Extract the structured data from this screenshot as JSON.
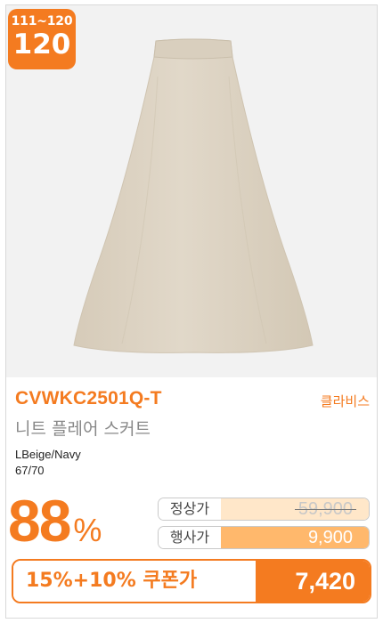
{
  "badge": {
    "range": "111~120",
    "size": "120"
  },
  "product": {
    "code": "CVWKC2501Q-T",
    "brand": "클라비스",
    "name": "니트 플레어 스커트",
    "color": "LBeige/Navy",
    "sizes": "67/70"
  },
  "pricing": {
    "discount_number": "88",
    "discount_unit": "%",
    "regular_label": "정상가",
    "regular_price": "59,900",
    "event_label": "행사가",
    "event_price": "9,900",
    "coupon_label": "15%+10% 쿠폰가",
    "coupon_price": "7,420"
  },
  "colors": {
    "accent": "#f47b20",
    "skirt": "#ddd3c3",
    "image_bg": "#f2f2f2"
  }
}
